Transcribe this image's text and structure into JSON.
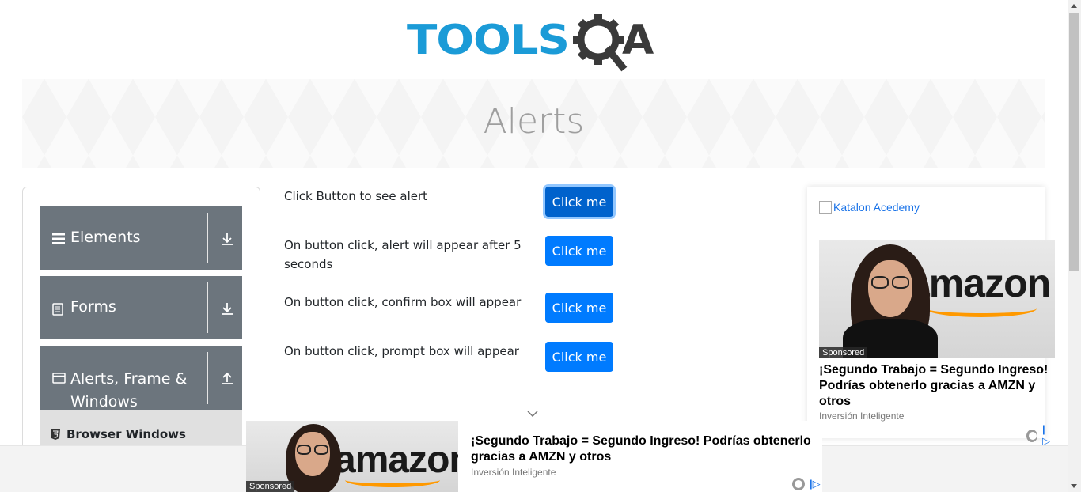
{
  "header": {
    "logo_text_left": "TOOLS",
    "logo_text_right": "QA",
    "logo_colors": {
      "tools": "#1b9bd7",
      "qa": "#3a3a3a"
    }
  },
  "banner": {
    "title": "Alerts"
  },
  "sidebar": {
    "groups": [
      {
        "label": "Elements",
        "icon": "hamburger-icon",
        "arrow": "download-arrow-icon"
      },
      {
        "label": "Forms",
        "icon": "document-icon",
        "arrow": "download-arrow-icon"
      },
      {
        "label_line1": "Alerts, Frame &",
        "label_line2": "Windows",
        "icon": "window-icon",
        "arrow": "upload-arrow-icon"
      }
    ],
    "submenu": [
      {
        "label": "Browser Windows",
        "icon": "html5-icon"
      }
    ]
  },
  "alerts": [
    {
      "text": "Click Button to see alert",
      "button": "Click me",
      "state": "focused"
    },
    {
      "text_line1": "On button click, alert will appear after 5",
      "text_line2": "seconds",
      "button": "Click me"
    },
    {
      "text": "On button click, confirm box will appear",
      "button": "Click me"
    },
    {
      "text": "On button click, prompt box will appear",
      "button": "Click me"
    }
  ],
  "ad_right": {
    "broken_image_alt": "Katalon Acedemy",
    "sponsored": "Sponsored",
    "brand": "amazon",
    "title_line1": "¡Segundo Trabajo = Segundo Ingreso!",
    "title_line2": "Podrías obtenerlo gracias a AMZN y",
    "title_line3": "otros",
    "source": "Inversión Inteligente"
  },
  "ad_bottom": {
    "sponsored": "Sponsored",
    "brand": "amazon",
    "title_line1": "¡Segundo Trabajo = Segundo Ingreso! Podrías obtenerlo",
    "title_line2": "gracias a AMZN y otros",
    "source": "Inversión Inteligente"
  },
  "colors": {
    "primary_button": "#007bff",
    "sidebar_group": "#6c757d",
    "banner_title": "#9e9e9e"
  }
}
